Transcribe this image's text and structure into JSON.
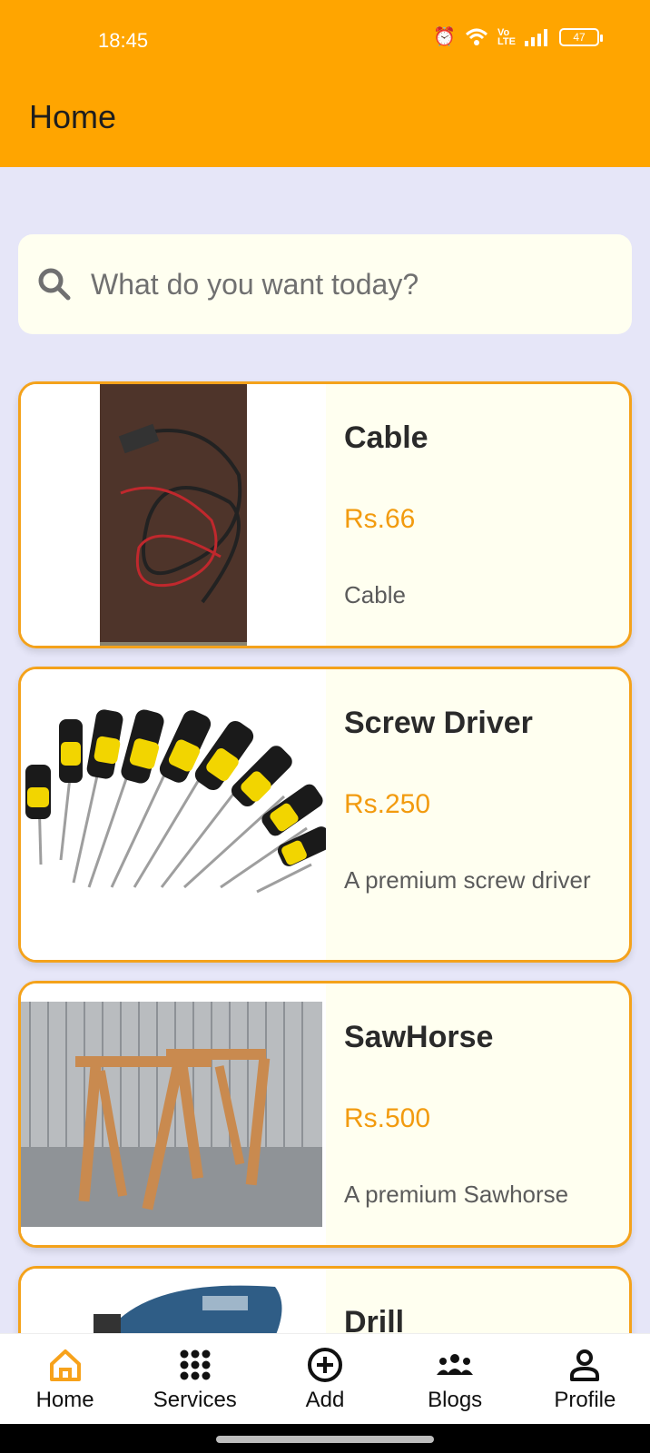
{
  "status": {
    "time": "18:45",
    "battery": "47"
  },
  "header": {
    "title": "Home"
  },
  "search": {
    "placeholder": "What do you want today?"
  },
  "products": [
    {
      "name": "Cable",
      "price": "Rs.66",
      "description": "Cable"
    },
    {
      "name": "Screw Driver",
      "price": "Rs.250",
      "description": "A premium screw driver"
    },
    {
      "name": "SawHorse",
      "price": "Rs.500",
      "description": "A premium Sawhorse"
    },
    {
      "name": "Drill"
    }
  ],
  "nav": {
    "home": "Home",
    "services": "Services",
    "add": "Add",
    "blogs": "Blogs",
    "profile": "Profile"
  },
  "colors": {
    "accent": "#ffa500",
    "price": "#f29b0f",
    "card_border": "#f4a21b",
    "background": "#e6e6f8"
  }
}
